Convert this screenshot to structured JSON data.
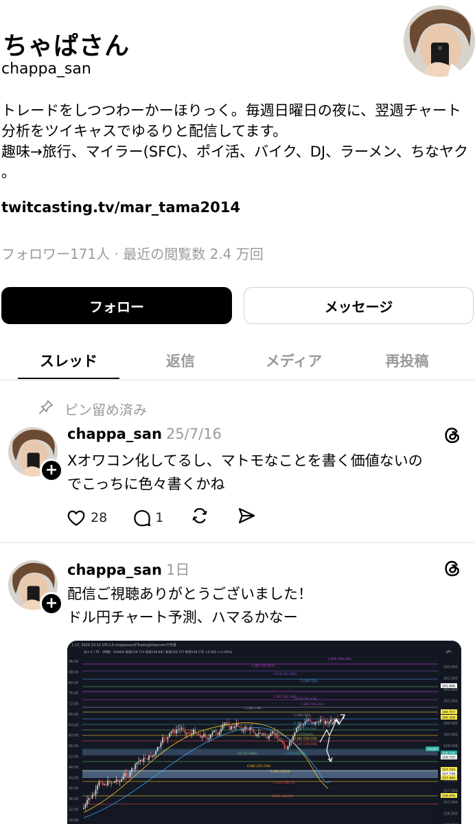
{
  "profile": {
    "display_name": "ちゃぱさん",
    "handle": "chappa_san",
    "bio_lines": [
      "トレードをしつつわーかーほりっく。毎週日曜日の夜に、翌週チャート分析をツイキャスでゆるりと配信してます。",
      "趣味→旅行、マイラー(SFC)、ポイ活、バイク、DJ、ラーメン、ちなヤク 。"
    ],
    "link": "twitcasting.tv/mar_tama2014",
    "stats": "フォロワー171人 · 最近の閲覧数 2.4 万回",
    "follow_label": "フォロー",
    "message_label": "メッセージ"
  },
  "tabs": [
    {
      "label": "スレッド",
      "active": true
    },
    {
      "label": "返信",
      "active": false
    },
    {
      "label": "メディア",
      "active": false
    },
    {
      "label": "再投稿",
      "active": false
    }
  ],
  "pinned_label": "ピン留め済み",
  "posts": [
    {
      "username": "chappa_san",
      "date": "25/7/16",
      "text_lines": [
        "Xオワコン化してるし、マトモなことを書く価値ないの",
        "でこっちに色々書くかね"
      ],
      "likes": "28",
      "replies": "1"
    },
    {
      "username": "chappa_san",
      "date": "1日",
      "text_lines": [
        "配信ご視聴ありがとうございました！",
        "ドル円チャート予測、ハマるかなー"
      ]
    }
  ],
  "chart_image": {
    "header_text": "1 17, 2026 23:15 UTC+9 chappasanがTradingView.comで作成",
    "symbol_line": "米ドル / 円 · 1時間 · OANDA 始値158.774 高値158.887 安値158.737 終値158.776 +0.002 (+0.00%)",
    "currency": "JPY",
    "left_axis": [
      "96.00",
      "88.00",
      "80.00",
      "76.00",
      "72.00",
      "68.00",
      "64.00",
      "60.00",
      "56.00",
      "52.00",
      "48.00",
      "44.00",
      "40.00",
      "36.00",
      "32.00",
      "28.00"
    ],
    "right_axis": [
      "163.000",
      "162.500",
      "162.000",
      "161.500",
      "161.000",
      "160.500",
      "160.000",
      "159.500",
      "159.000",
      "158.500",
      "158.000",
      "157.500",
      "157.000",
      "156.500",
      "156.000"
    ],
    "right_labels": [
      {
        "text": "161.966",
        "bg": "#f5f5f5",
        "fg": "#000"
      },
      {
        "text": "160.717",
        "bg": "#f7e94b",
        "fg": "#000"
      },
      {
        "text": "160.329",
        "bg": "#f7e94b",
        "fg": "#000"
      },
      {
        "text": "USDJPY",
        "bg": "#26a69a",
        "fg": "#fff"
      },
      {
        "text": "158.776",
        "bg": "#26a69a",
        "fg": "#fff"
      },
      {
        "text": "158.725",
        "bg": "#f5f5f5",
        "fg": "#000"
      },
      {
        "text": "157.743",
        "bg": "#f7e94b",
        "fg": "#000"
      },
      {
        "text": "157.736",
        "bg": "#f5f5f5",
        "fg": "#000"
      },
      {
        "text": "157.494",
        "bg": "#f7e94b",
        "fg": "#000"
      },
      {
        "text": "156.476",
        "bg": "#f7e94b",
        "fg": "#000"
      }
    ],
    "fib_labels": [
      {
        "text": "2.618 (163.232)",
        "color": "#e040fb"
      },
      {
        "text": "1.382 (162.814)",
        "color": "#ab47bc"
      },
      {
        "text": "1.618 (162.469)",
        "color": "#7e57c2"
      },
      {
        "text": "2 (162.123)",
        "color": "#42a5f5"
      },
      {
        "text": "1.382 (161.389)",
        "color": "#ab47bc"
      },
      {
        "text": "1.618 (161.436)",
        "color": "#7e57c2"
      },
      {
        "text": "1.382 (161.203)",
        "color": "#ab47bc"
      },
      {
        "text": "1 (160.739)",
        "color": "#9e9e9e"
      },
      {
        "text": "1 (160.329)",
        "color": "#9e9e9e"
      },
      {
        "text": "0.764 (159.906)",
        "color": "#42a5f5"
      },
      {
        "text": "0.618 (159.644)",
        "color": "#26a69a"
      },
      {
        "text": "0.5 (159.432)",
        "color": "#66bb6a"
      },
      {
        "text": "0.382 (159.220)",
        "color": "#ffca28"
      },
      {
        "text": "0.236 (158.958)",
        "color": "#ef5350"
      },
      {
        "text": "0.5 (157.891)",
        "color": "#66bb6a"
      },
      {
        "text": "0.618 (157.5)",
        "color": "#26a69a"
      },
      {
        "text": "0.382 (157.219)",
        "color": "#ffca28"
      },
      {
        "text": "0.382 (156.8)",
        "color": "#ffca28"
      },
      {
        "text": "0.236 (156.71)",
        "color": "#ef5350"
      },
      {
        "text": "0.236 (156.01)",
        "color": "#ef5350"
      }
    ]
  }
}
